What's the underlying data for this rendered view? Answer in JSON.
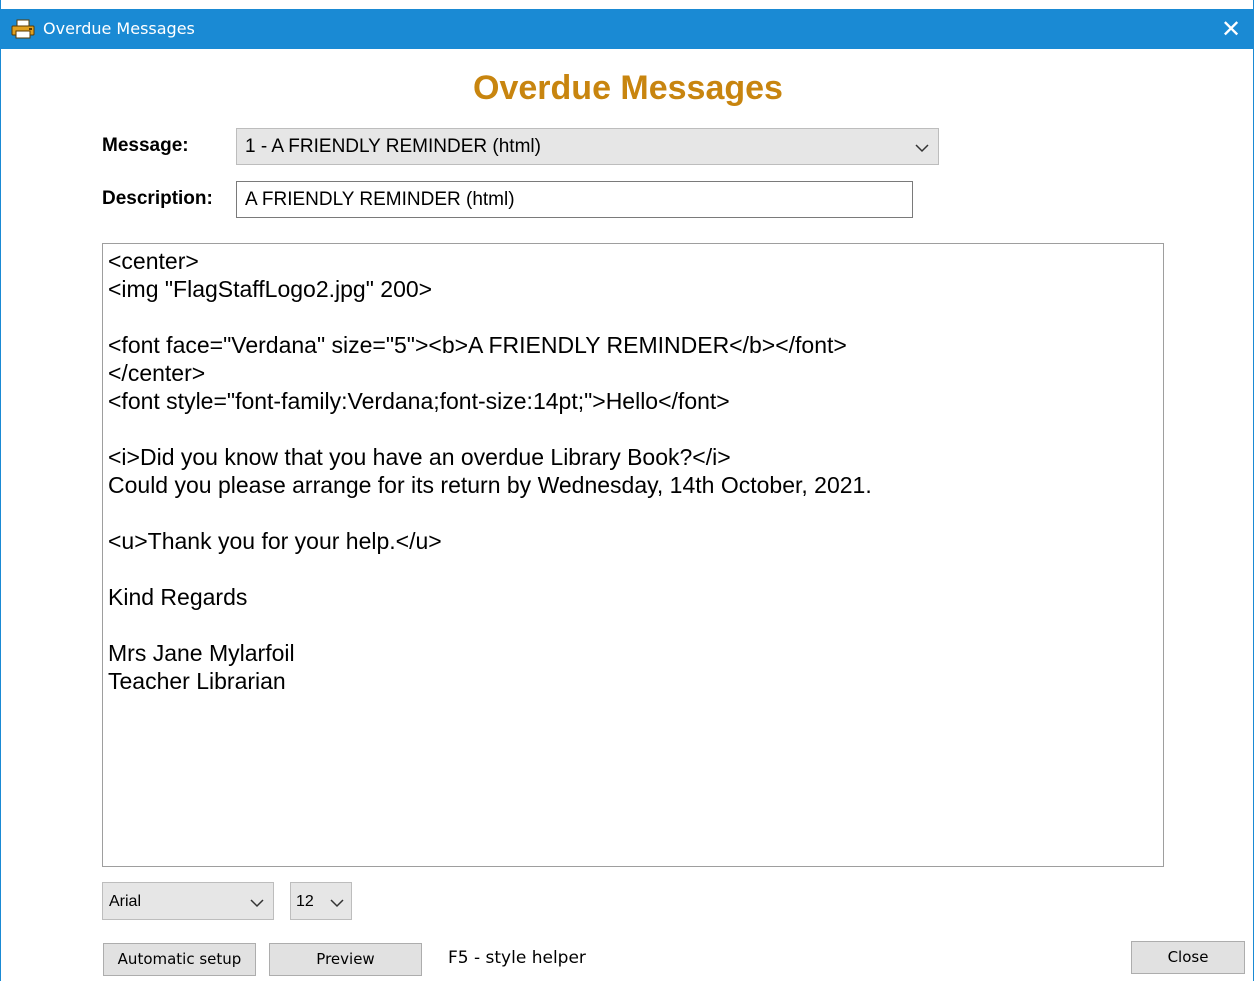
{
  "window": {
    "title": "Overdue Messages",
    "close_glyph": "✕",
    "titlebar_color": "#1a8ad4"
  },
  "heading": {
    "text": "Overdue Messages",
    "color": "#c8850f"
  },
  "form": {
    "message_label": "Message:",
    "message_value": "1 - A FRIENDLY REMINDER (html)",
    "description_label": "Description:",
    "description_value": "A FRIENDLY REMINDER (html)"
  },
  "editor": {
    "lines": [
      "<center>",
      "<img \"FlagStaffLogo2.jpg\" 200>",
      "",
      "<font face=\"Verdana\" size=\"5\"><b>A FRIENDLY REMINDER</b></font>",
      "</center>",
      "<font style=\"font-family:Verdana;font-size:14pt;\">Hello</font>",
      "",
      "<i>Did you know that you have an overdue Library Book?</i>",
      "Could you please arrange for its return by Wednesday, 14th October, 2021.",
      "",
      "<u>Thank you for your help.</u>",
      "",
      "Kind Regards",
      "",
      "Mrs Jane Mylarfoil",
      "Teacher Librarian"
    ]
  },
  "font_controls": {
    "font_name": "Arial",
    "font_size": "12"
  },
  "buttons": {
    "automatic_setup": "Automatic setup",
    "preview": "Preview",
    "close": "Close"
  },
  "hint": "F5 - style helper",
  "icons": {
    "app": "printer-icon",
    "close": "close-icon",
    "dropdown": "chevron-down-icon"
  }
}
